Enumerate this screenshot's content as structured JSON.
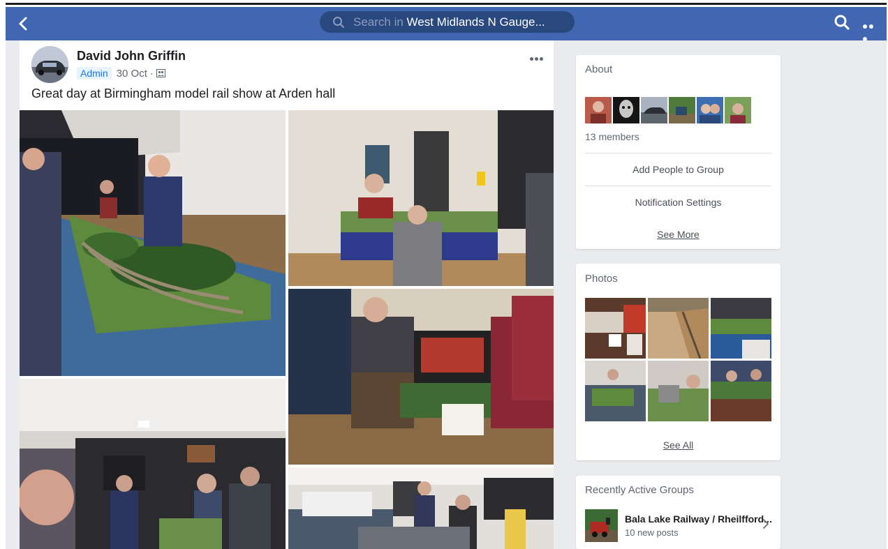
{
  "topbar": {
    "search_prefix": "Search in ",
    "search_group": "West Midlands N Gauge..."
  },
  "post": {
    "author": "David John Griffin",
    "badge": "Admin",
    "time": "30 Oct",
    "separator": "·",
    "text": "Great day at Birmingham model rail show at Arden hall"
  },
  "about": {
    "title": "About",
    "members": "13 members",
    "add_people": "Add People to Group",
    "notifications": "Notification Settings",
    "see_more": "See More"
  },
  "photos": {
    "title": "Photos",
    "see_all": "See All"
  },
  "recent_groups": {
    "title": "Recently Active Groups",
    "items": [
      {
        "name": "Bala Lake Railway / Rheilfford...",
        "sub": "10 new posts"
      }
    ]
  },
  "icons": {
    "back": "chevron-left-icon",
    "search": "search-icon",
    "more": "more-horizontal-icon",
    "group": "group-audience-icon",
    "chevron_right": "chevron-right-icon"
  },
  "colors": {
    "topbar": "#4267b2",
    "search_pill": "#29487d",
    "page_bg": "#e9ebee",
    "admin_badge_bg": "#e7f3ff",
    "admin_badge_text": "#1877f2"
  }
}
